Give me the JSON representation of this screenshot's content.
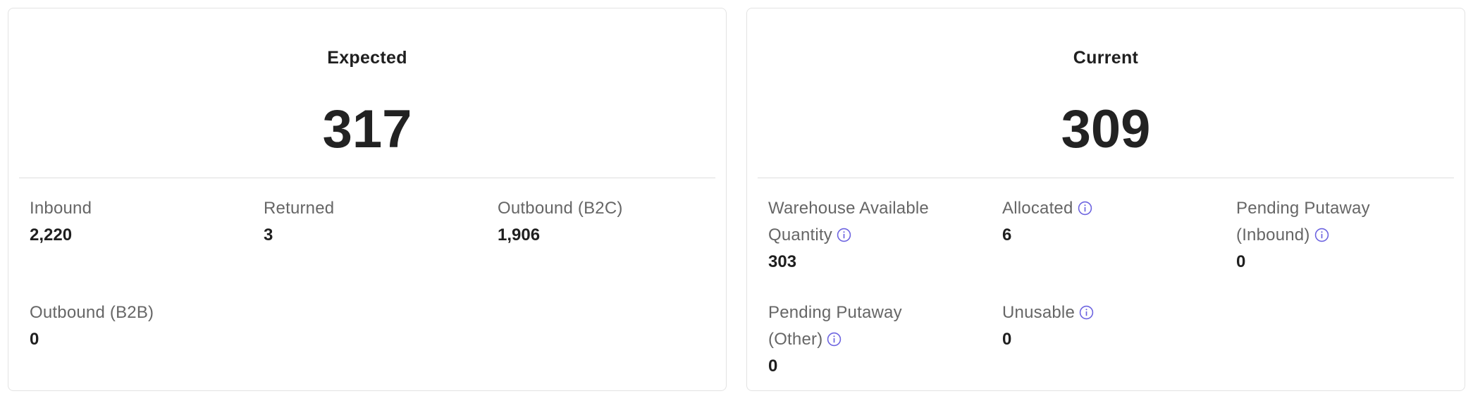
{
  "expected": {
    "title": "Expected",
    "total": "317",
    "stats": [
      {
        "label": "Inbound",
        "value": "2,220"
      },
      {
        "label": "Returned",
        "value": "3"
      },
      {
        "label": "Outbound (B2C)",
        "value": "1,906"
      },
      {
        "label": "Outbound (B2B)",
        "value": "0"
      }
    ]
  },
  "current": {
    "title": "Current",
    "total": "309",
    "stats": [
      {
        "label_line1": "Warehouse Available",
        "label_line2": "Quantity",
        "value": "303",
        "icon": "info-icon"
      },
      {
        "label": "Allocated",
        "value": "6",
        "icon": "info-icon"
      },
      {
        "label_line1": "Pending Putaway",
        "label_line2": "(Inbound)",
        "value": "0",
        "icon": "info-icon"
      },
      {
        "label_line1": "Pending Putaway",
        "label_line2": "(Other)",
        "value": "0",
        "icon": "info-icon"
      },
      {
        "label": "Unusable",
        "value": "0",
        "icon": "info-icon"
      }
    ]
  },
  "colors": {
    "info_icon": "#6c63e0",
    "border": "#e3e3e3",
    "label": "#666666",
    "value": "#1f1f1f"
  }
}
